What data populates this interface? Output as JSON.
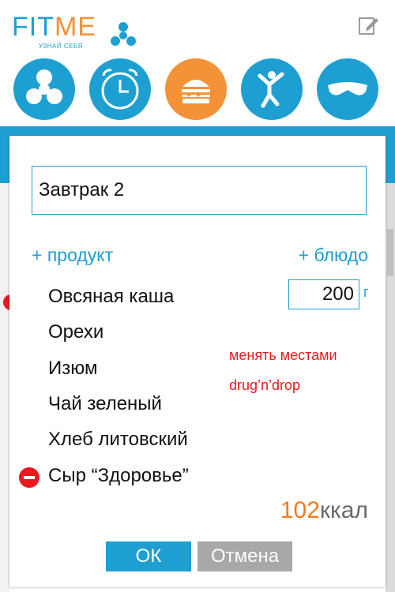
{
  "brand": {
    "name_part1": "FIT",
    "name_part2": "ME",
    "tagline": "УЗНАЙ СЕБЯ"
  },
  "header": {
    "edit_icon": "edit-icon"
  },
  "nav": [
    {
      "icon": "fan-icon",
      "active": false
    },
    {
      "icon": "alarm-clock-icon",
      "active": false
    },
    {
      "icon": "burger-icon",
      "active": true
    },
    {
      "icon": "person-jumping-icon",
      "active": false
    },
    {
      "icon": "sleep-mask-icon",
      "active": false
    }
  ],
  "dialog": {
    "meal_name": "Завтрак 2",
    "add_product_label": "+ продукт",
    "add_dish_label": "+ блюдо",
    "items": [
      {
        "name": "Овсяная каша"
      },
      {
        "name": "Орехи"
      },
      {
        "name": "Изюм"
      },
      {
        "name": "Чай зеленый"
      },
      {
        "name": "Хлеб литовский"
      },
      {
        "name": "Сыр “Здоровье”"
      }
    ],
    "quantity": {
      "value": "200",
      "unit": "г"
    },
    "note_line1": "менять местами",
    "note_line2": "drug’n’drop",
    "kcal_value": "102",
    "kcal_unit": "ккал",
    "ok_label": "ОК",
    "cancel_label": "Отмена"
  },
  "colors": {
    "primary": "#1e9fd2",
    "accent": "#f39237",
    "danger": "#e8191f",
    "muted": "#a8a8a8"
  }
}
